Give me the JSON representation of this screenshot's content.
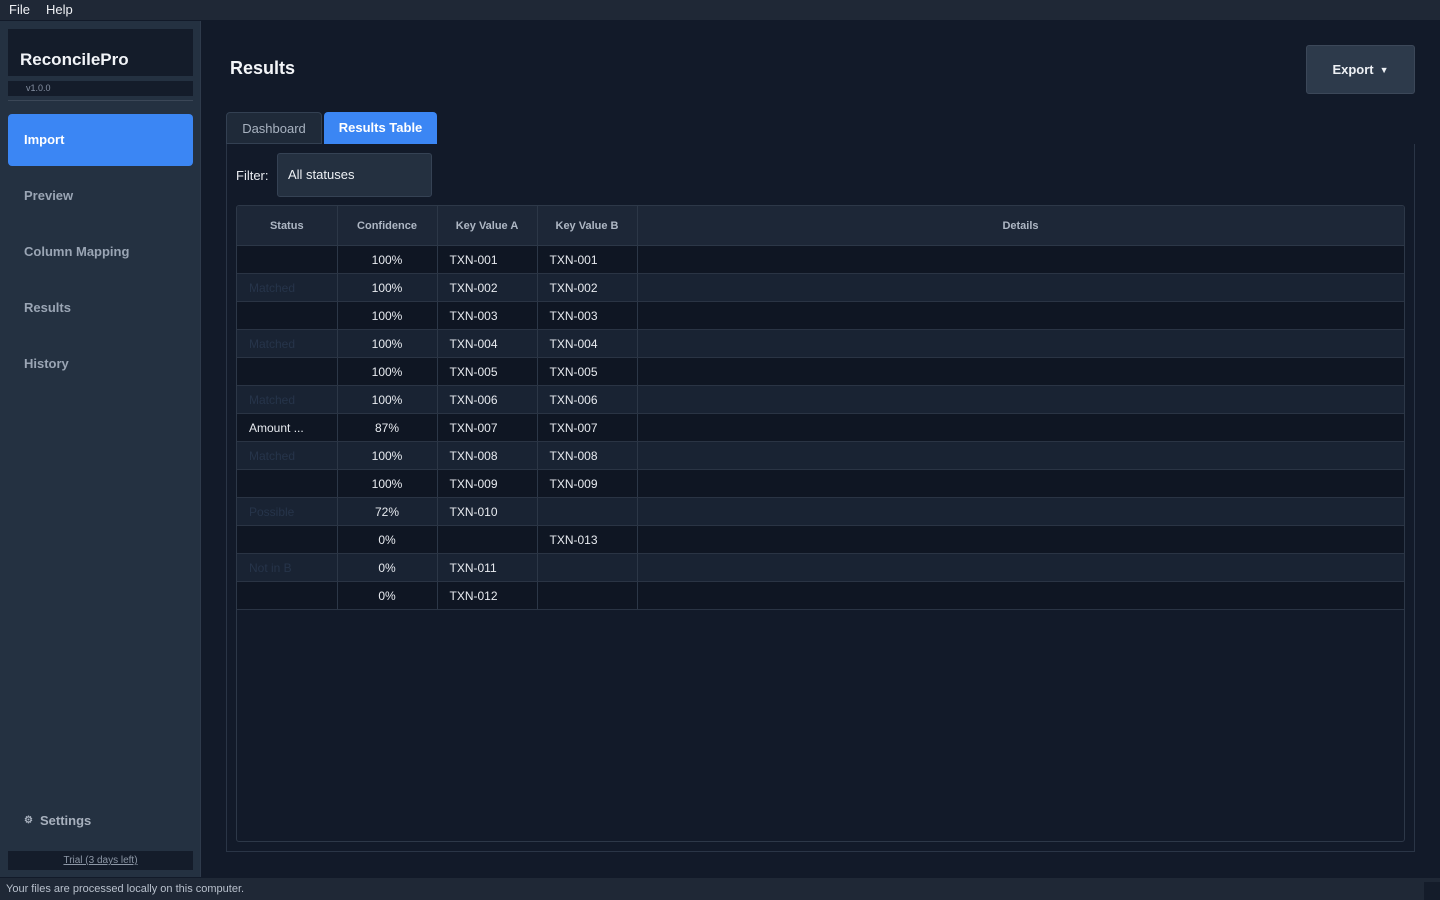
{
  "menu": {
    "file": "File",
    "help": "Help"
  },
  "sidebar": {
    "brand": "ReconcilePro",
    "version": "v1.0.0",
    "items": [
      {
        "label": "Import",
        "active": true
      },
      {
        "label": "Preview",
        "active": false
      },
      {
        "label": "Column Mapping",
        "active": false
      },
      {
        "label": "Results",
        "active": false
      },
      {
        "label": "History",
        "active": false
      }
    ],
    "settings_label": "Settings",
    "trial_label": "Trial (3 days left)"
  },
  "header": {
    "title": "Results",
    "export_label": "Export"
  },
  "tabs": [
    {
      "label": "Dashboard",
      "active": false
    },
    {
      "label": "Results Table",
      "active": true
    }
  ],
  "filter": {
    "label": "Filter:",
    "value": "All statuses"
  },
  "table": {
    "columns": [
      "Status",
      "Confidence",
      "Key Value A",
      "Key Value B",
      "Details"
    ],
    "rows": [
      {
        "status": "",
        "confidence": "100%",
        "a": "TXN-001",
        "b": "TXN-001",
        "details": ""
      },
      {
        "status": "Matched",
        "confidence": "100%",
        "a": "TXN-002",
        "b": "TXN-002",
        "details": ""
      },
      {
        "status": "",
        "confidence": "100%",
        "a": "TXN-003",
        "b": "TXN-003",
        "details": ""
      },
      {
        "status": "Matched",
        "confidence": "100%",
        "a": "TXN-004",
        "b": "TXN-004",
        "details": ""
      },
      {
        "status": "",
        "confidence": "100%",
        "a": "TXN-005",
        "b": "TXN-005",
        "details": ""
      },
      {
        "status": "Matched",
        "confidence": "100%",
        "a": "TXN-006",
        "b": "TXN-006",
        "details": ""
      },
      {
        "status": "Amount ...",
        "confidence": "87%",
        "a": "TXN-007",
        "b": "TXN-007",
        "details": ""
      },
      {
        "status": "Matched",
        "confidence": "100%",
        "a": "TXN-008",
        "b": "TXN-008",
        "details": ""
      },
      {
        "status": "",
        "confidence": "100%",
        "a": "TXN-009",
        "b": "TXN-009",
        "details": ""
      },
      {
        "status": "Possible",
        "confidence": "72%",
        "a": "TXN-010",
        "b": "",
        "details": ""
      },
      {
        "status": "",
        "confidence": "0%",
        "a": "",
        "b": "TXN-013",
        "details": ""
      },
      {
        "status": "Not in B",
        "confidence": "0%",
        "a": "TXN-011",
        "b": "",
        "details": ""
      },
      {
        "status": "",
        "confidence": "0%",
        "a": "TXN-012",
        "b": "",
        "details": ""
      }
    ]
  },
  "statusbar": {
    "text": "Your files are processed locally on this computer."
  }
}
